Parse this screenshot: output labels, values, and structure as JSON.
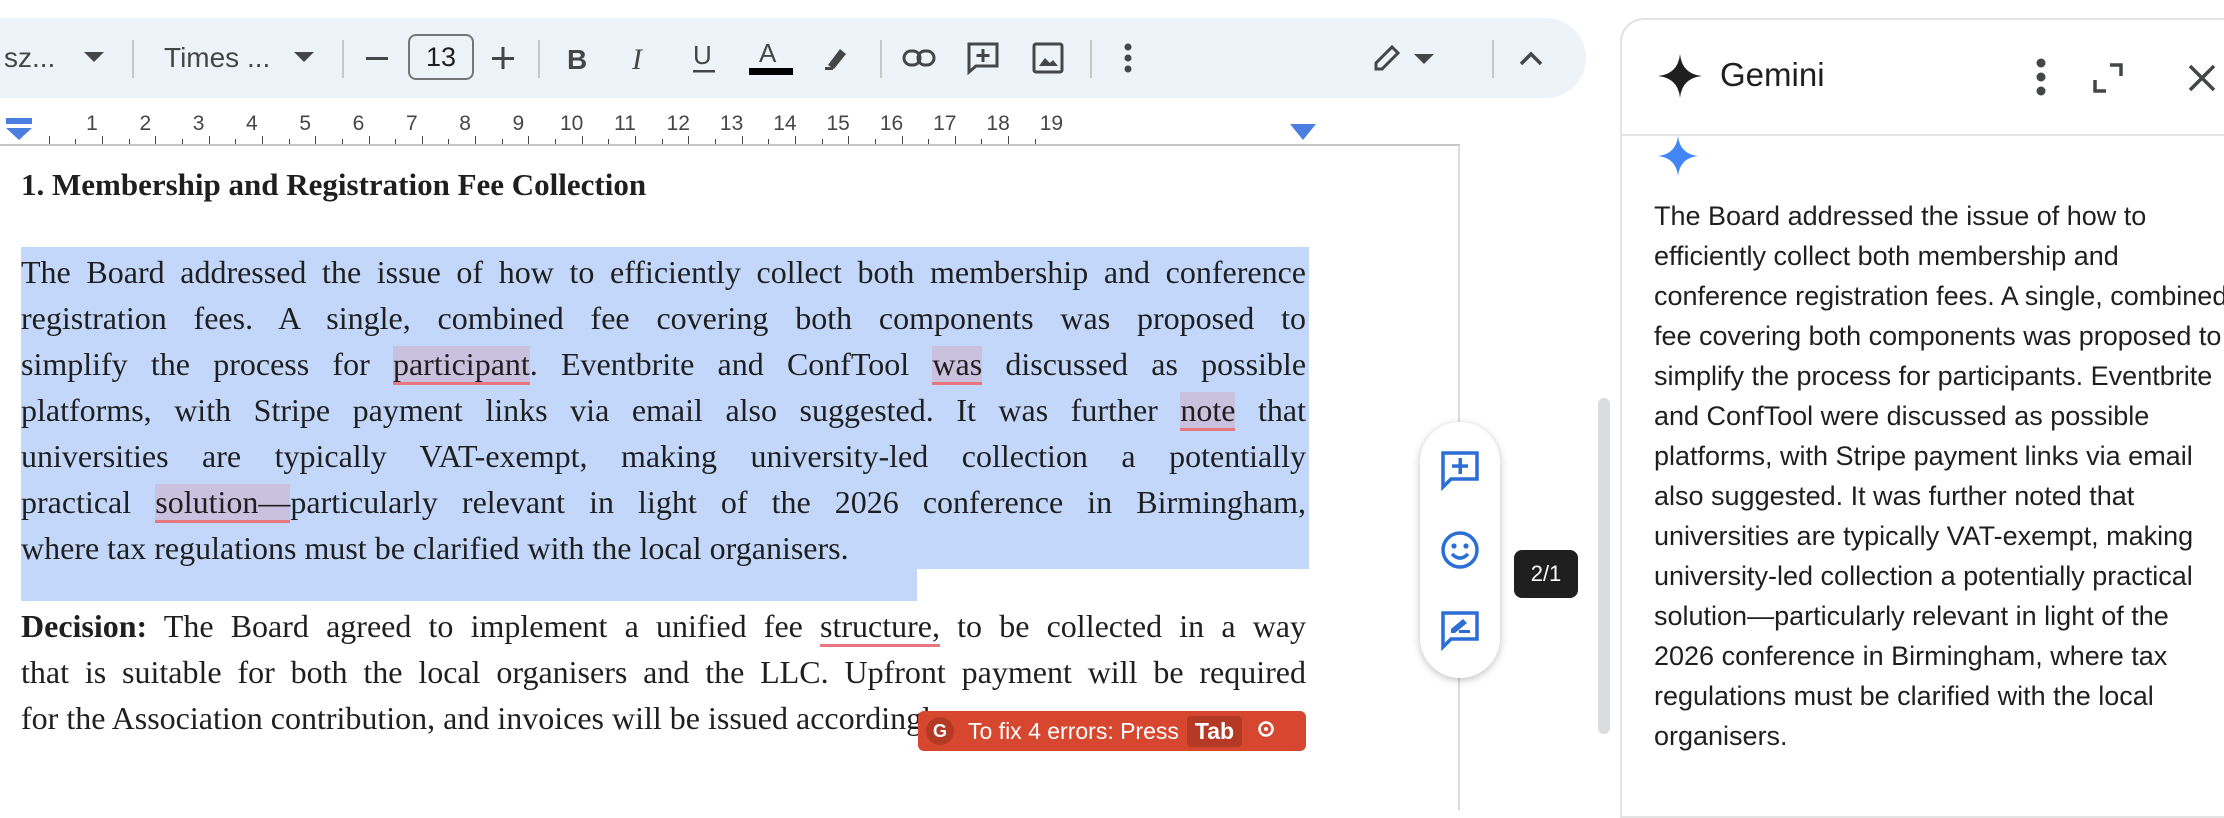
{
  "toolbar": {
    "font_style": "sz...",
    "font_family": "Times ...",
    "font_size": "13",
    "icons": [
      "chevron-down-icon",
      "minus-icon",
      "plus-icon",
      "bold-icon",
      "italic-icon",
      "underline-icon",
      "text-color-icon",
      "highlight-icon",
      "link-icon",
      "add-comment-icon",
      "image-icon",
      "more-vert-icon",
      "edit-mode-icon",
      "collapse-icon"
    ]
  },
  "ruler": {
    "numbers": [
      "1",
      "2",
      "3",
      "4",
      "5",
      "6",
      "7",
      "8",
      "9",
      "10",
      "11",
      "12",
      "13",
      "14",
      "15",
      "16",
      "17",
      "18",
      "19"
    ]
  },
  "document": {
    "heading": "1. Membership and Registration Fee Collection",
    "para1_lines": [
      [
        "The Board addressed the issue of how to efficiently collect both membership and conference"
      ],
      [
        "registration fees. A single, combined fee covering both components was proposed to"
      ],
      [
        "simplify the process for ",
        "participant",
        ". Eventbrite and ConfTool ",
        "was",
        " discussed as possible"
      ],
      [
        "platforms, with Stripe payment links via email also suggested. It was further ",
        "note",
        " that"
      ],
      [
        "universities are typically VAT-exempt, making university-led collection a potentially"
      ],
      [
        "practical ",
        "solution—",
        "particularly relevant in light of the 2026 conference in Birmingham,"
      ],
      [
        "where tax regulations must be clarified with the local organisers."
      ]
    ],
    "decision_label": "Decision:",
    "decision_lines": [
      [
        " The Board agreed to implement a unified fee ",
        "structure,",
        " to be collected in a way"
      ],
      [
        "that is suitable for both the local organisers and the LLC. Upfront payment will be required"
      ],
      [
        "for the Association contribution, and invoices will be issued accordingly."
      ]
    ]
  },
  "grammarly": {
    "message": "To fix 4 errors: Press",
    "key": "Tab",
    "logo": "G"
  },
  "page_badge": "2/1",
  "gemini": {
    "title": "Gemini",
    "body": "The Board addressed the issue of how to efficiently collect both membership and conference registration fees. A single, combined fee covering both components was proposed to simplify the process for participants. Eventbrite and ConfTool were discussed as possible platforms, with Stripe payment links via email also suggested. It was further noted that universities are typically VAT-exempt, making university-led collection a potentially practical solution—particularly relevant in light of the 2026 conference in Birmingham, where tax regulations must be clarified with the local organisers."
  },
  "colors": {
    "selection": "#c2d7fa",
    "grammarly": "#d7472f",
    "gemini_star": "#4285f4",
    "toolbar_bg": "#eef2f9"
  }
}
